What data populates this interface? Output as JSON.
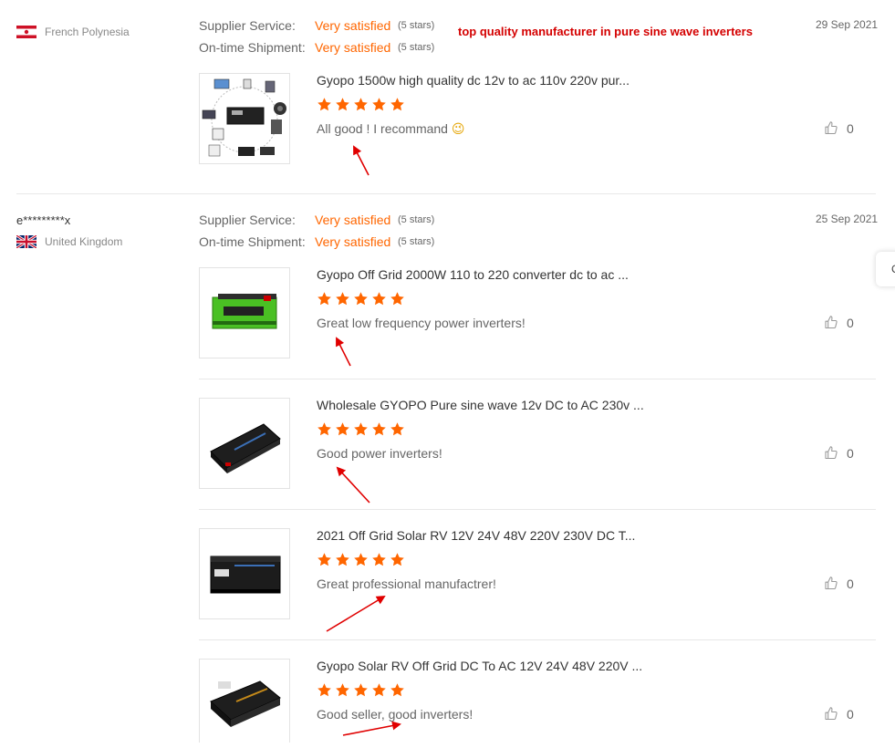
{
  "reviews": [
    {
      "country": "French Polynesia",
      "date": "29 Sep 2021",
      "supplier_label": "Supplier Service:",
      "supplier_value": "Very satisfied",
      "supplier_stars": "(5 stars)",
      "shipment_label": "On-time Shipment:",
      "shipment_value": "Very satisfied",
      "shipment_stars": "(5 stars)",
      "annotation": "top quality manufacturer in pure sine wave inverters",
      "items": [
        {
          "product": "Gyopo 1500w high quality dc 12v to ac 110v 220v pur...",
          "rating": 5,
          "text": "All good ! I recommand",
          "emoji": "😉",
          "likes": "0"
        }
      ]
    },
    {
      "user": "e*********x",
      "country": "United Kingdom",
      "date": "25 Sep 2021",
      "supplier_label": "Supplier Service:",
      "supplier_value": "Very satisfied",
      "supplier_stars": "(5 stars)",
      "shipment_label": "On-time Shipment:",
      "shipment_value": "Very satisfied",
      "shipment_stars": "(5 stars)",
      "items": [
        {
          "product": "Gyopo Off Grid 2000W 110 to 220 converter dc to ac ...",
          "rating": 5,
          "text": "Great low frequency power inverters!",
          "likes": "0"
        },
        {
          "product": "Wholesale GYOPO Pure sine wave 12v DC to AC 230v ...",
          "rating": 5,
          "text": "Good power inverters!",
          "likes": "0"
        },
        {
          "product": "2021 Off Grid Solar RV 12V 24V 48V 220V 230V DC T...",
          "rating": 5,
          "text": "Great professional manufactrer!",
          "likes": "0"
        },
        {
          "product": "Gyopo Solar RV Off Grid DC To AC 12V 24V 48V 220V ...",
          "rating": 5,
          "text": "Good seller, good inverters!",
          "likes": "0"
        }
      ]
    }
  ],
  "colors": {
    "accent": "#ff6600",
    "annotation": "#d40000",
    "star": "#ff6600"
  },
  "icons": {
    "like": "thumbs-up-icon",
    "star": "star-icon"
  },
  "side_tab": {
    "label": "C"
  }
}
